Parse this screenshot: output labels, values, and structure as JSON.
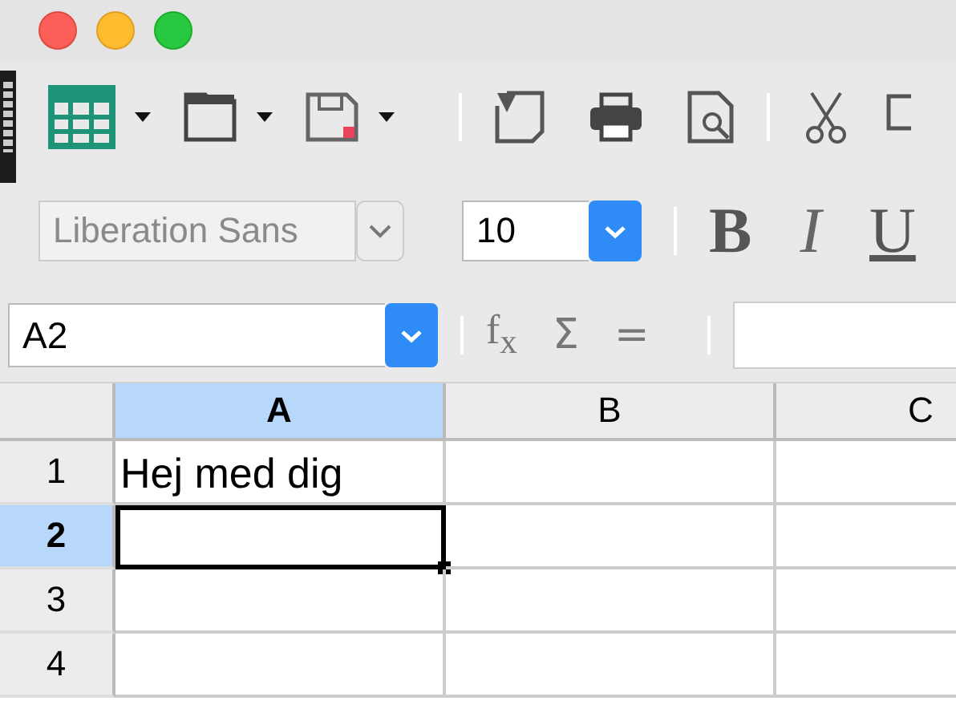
{
  "formatting_toolbar": {
    "font_name": "Liberation Sans",
    "font_size": "10",
    "style_buttons": [
      {
        "kind": "bold",
        "label": "B"
      },
      {
        "kind": "italic",
        "label": "I"
      },
      {
        "kind": "underline",
        "label": "U"
      }
    ]
  },
  "formula_bar": {
    "name_box": "A2",
    "functions": [
      {
        "kind": "fx",
        "label": "f$_{x}$"
      },
      {
        "kind": "sum",
        "label": "Σ"
      },
      {
        "kind": "equals",
        "label": "="
      }
    ]
  },
  "sheet": {
    "columns": [
      {
        "label": "A",
        "selected": true
      },
      {
        "label": "B",
        "selected": false
      },
      {
        "label": "C",
        "selected": false
      }
    ],
    "rows": [
      {
        "label": "1",
        "selected": false,
        "cells": [
          {
            "text": "Hej med dig",
            "selected": false
          },
          {
            "selected": false
          },
          {
            "selected": false
          }
        ]
      },
      {
        "label": "2",
        "selected": true,
        "cells": [
          {
            "selected": true
          },
          {
            "selected": false
          },
          {
            "selected": false
          }
        ]
      },
      {
        "label": "3",
        "selected": false,
        "cells": [
          {
            "selected": false
          },
          {
            "selected": false
          },
          {
            "selected": false
          }
        ]
      },
      {
        "label": "4",
        "selected": false,
        "cells": [
          {
            "selected": false
          },
          {
            "selected": false
          },
          {
            "selected": false
          }
        ]
      }
    ]
  }
}
